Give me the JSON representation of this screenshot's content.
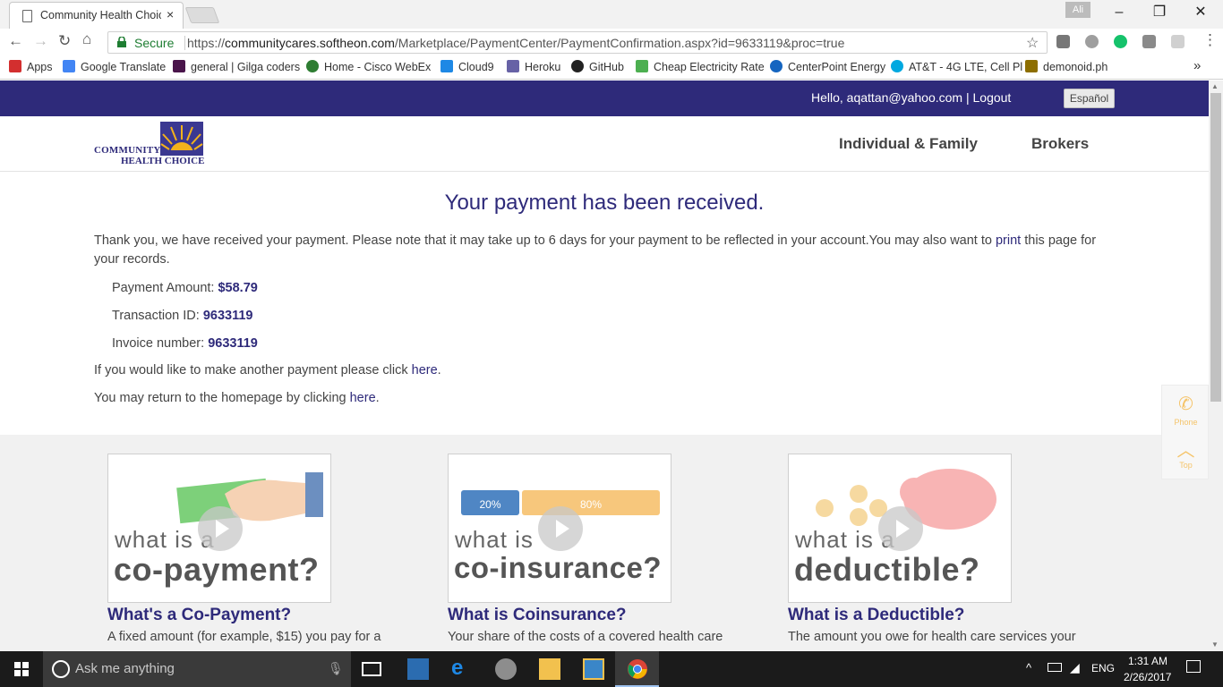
{
  "browser": {
    "tab_title": "Community Health Choic",
    "tab_close": "×",
    "profile": "Ali",
    "secure_label": "Secure",
    "url_scheme": "https://",
    "url_host": "communitycares.softheon.com",
    "url_path": "/Marketplace/PaymentCenter/PaymentConfirmation.aspx?id=9633119&proc=true",
    "bookmarks": [
      {
        "label": "Apps",
        "color": "#d32f2f"
      },
      {
        "label": "Google Translate",
        "color": "#4285f4"
      },
      {
        "label": "general | Gilga coders",
        "color": "#4a154b"
      },
      {
        "label": "Home - Cisco WebEx",
        "color": "#2e7d32"
      },
      {
        "label": "Cloud9",
        "color": "#1e88e5"
      },
      {
        "label": "Heroku",
        "color": "#6762a6"
      },
      {
        "label": "GitHub",
        "color": "#222222"
      },
      {
        "label": "Cheap Electricity Rate",
        "color": "#4caf50"
      },
      {
        "label": "CenterPoint Energy",
        "color": "#1565c0"
      },
      {
        "label": "AT&T - 4G LTE, Cell Pl",
        "color": "#00a8e0"
      },
      {
        "label": "demonoid.ph",
        "color": "#8d6e00"
      }
    ],
    "more_bookmarks": "»"
  },
  "site": {
    "greeting": "Hello, aqattan@yahoo.com | Logout",
    "espanol": "Español",
    "logo_line1": "COMMUNITY",
    "logo_line2": "HEALTH CHOICE",
    "nav": [
      "Individual & Family",
      "Brokers"
    ]
  },
  "confirmation": {
    "title": "Your payment has been received.",
    "thank_you_before": "Thank you, we have received your payment. Please note that it may take up to 6 days for your payment to be reflected in your account.You may also want to ",
    "print_link": "print",
    "thank_you_after": " this page for your records.",
    "payment_amount_label": "Payment Amount: ",
    "payment_amount": "$58.79",
    "transaction_label": "Transaction ID: ",
    "transaction_id": "9633119",
    "invoice_label": "Invoice number: ",
    "invoice_number": "9633119",
    "another_payment_text": "If you would like to make another payment please click ",
    "another_payment_link": "here",
    "homepage_text": "You may return to the homepage by clicking ",
    "homepage_link": "here",
    "period": "."
  },
  "cards": [
    {
      "thumb_line1": "what is a",
      "thumb_line2": "co-payment?",
      "title": "What's a Co-Payment?",
      "desc": "A fixed amount (for example, $15) you pay for a"
    },
    {
      "thumb_line1": "what is",
      "thumb_line2": "co-insurance?",
      "title": "What is Coinsurance?",
      "desc": "Your share of the costs of a covered health care",
      "bar_left": "20%",
      "bar_right": "80%"
    },
    {
      "thumb_line1": "what is a",
      "thumb_line2": "deductible?",
      "title": "What is a Deductible?",
      "desc": "The amount you owe for health care services your"
    }
  ],
  "side_widget": {
    "phone": "Phone",
    "top": "Top"
  },
  "taskbar": {
    "search_placeholder": "Ask me anything",
    "time": "1:31 AM",
    "date": "2/26/2017",
    "lang": "ENG"
  }
}
